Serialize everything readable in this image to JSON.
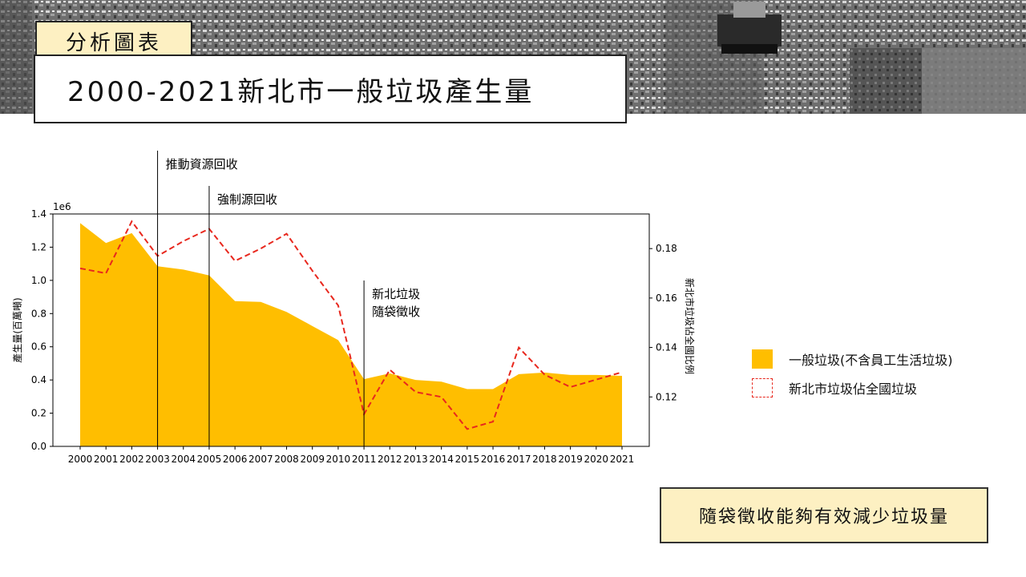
{
  "header": {
    "tag_label": "分析圖表",
    "title": "2000-2021新北市一般垃圾產生量"
  },
  "footer_note": "隨袋徵收能夠有效減少垃圾量",
  "colors": {
    "area": "#FFBE00",
    "line": "#E8281E",
    "tag_bg": "#FDF0C2"
  },
  "chart_data": {
    "type": "area",
    "categories": [
      "2000",
      "2001",
      "2002",
      "2003",
      "2004",
      "2005",
      "2006",
      "2007",
      "2008",
      "2009",
      "2010",
      "2011",
      "2012",
      "2013",
      "2014",
      "2015",
      "2016",
      "2017",
      "2018",
      "2019",
      "2020",
      "2021"
    ],
    "series": [
      {
        "name": "一般垃圾(不含員工生活垃圾)",
        "type": "area",
        "axis": "left",
        "values": [
          1.345,
          1.225,
          1.285,
          1.085,
          1.065,
          1.03,
          0.875,
          0.87,
          0.81,
          0.725,
          0.64,
          0.405,
          0.44,
          0.4,
          0.39,
          0.345,
          0.345,
          0.435,
          0.445,
          0.43,
          0.43,
          0.425
        ]
      },
      {
        "name": "新北市垃圾佔全國垃圾",
        "type": "line",
        "axis": "right",
        "values": [
          0.172,
          0.17,
          0.191,
          0.177,
          0.183,
          0.188,
          0.175,
          0.18,
          0.186,
          0.171,
          0.157,
          0.113,
          0.131,
          0.122,
          0.12,
          0.107,
          0.11,
          0.14,
          0.129,
          0.124,
          0.127,
          0.13
        ]
      }
    ],
    "ylabel": "產生量(百萬噸)",
    "y2label": "新北市垃圾佔全國比例",
    "ylim": [
      0,
      1.4
    ],
    "y2lim": [
      0.1,
      0.194
    ],
    "y_ticks": [
      "0.0",
      "0.2",
      "0.4",
      "0.6",
      "0.8",
      "1.0",
      "1.2",
      "1.4"
    ],
    "y2_ticks": [
      "0.12",
      "0.14",
      "0.16",
      "0.18"
    ],
    "y_offset_label": "1e6",
    "legend_position": "right",
    "annotations": [
      {
        "year": "2003",
        "lines": [
          "推動資源回收"
        ]
      },
      {
        "year": "2005",
        "lines": [
          "強制源回收"
        ]
      },
      {
        "year": "2011",
        "lines": [
          "新北垃圾",
          "隨袋徵收"
        ]
      }
    ]
  }
}
